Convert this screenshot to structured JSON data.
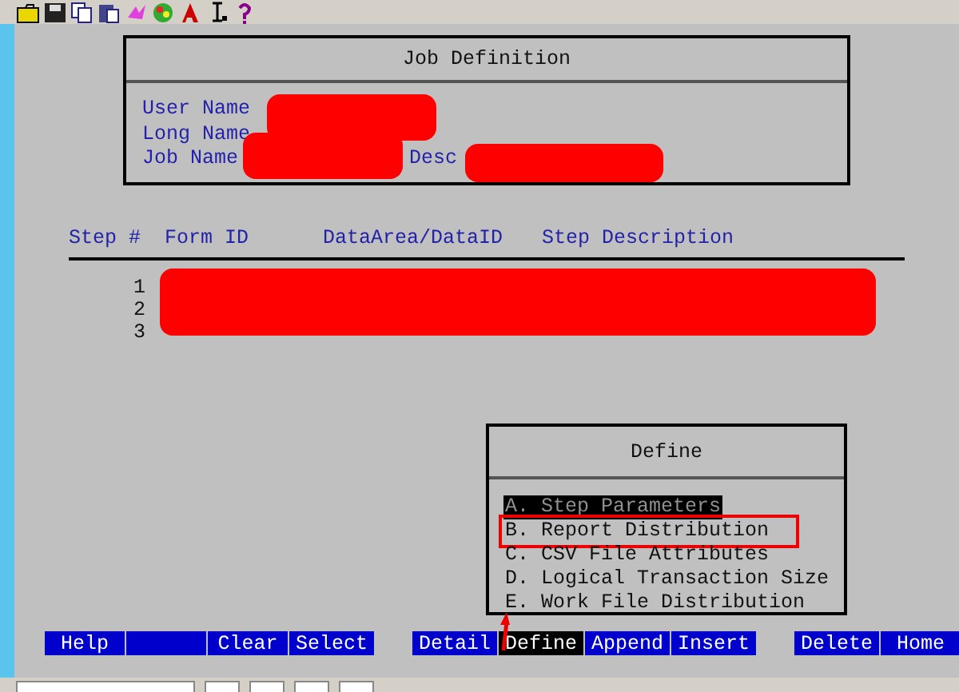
{
  "job_definition": {
    "title": "Job Definition",
    "fields": [
      {
        "label": "User Name"
      },
      {
        "label": "Long Name"
      },
      {
        "label": "Job Name"
      }
    ],
    "desc_label": "Desc"
  },
  "steps": {
    "columns": [
      "Step #",
      "Form ID",
      "DataArea/DataID",
      "Step Description"
    ],
    "rows": [
      {
        "step": "1"
      },
      {
        "step": "2"
      },
      {
        "step": "3"
      }
    ]
  },
  "define_menu": {
    "title": "Define",
    "items": [
      {
        "label": "A. Step Parameters",
        "selected": true,
        "annotated": false
      },
      {
        "label": "B. Report Distribution",
        "selected": false,
        "annotated": true
      },
      {
        "label": "C. CSV File Attributes",
        "selected": false,
        "annotated": false
      },
      {
        "label": "D. Logical Transaction Size",
        "selected": false,
        "annotated": false
      },
      {
        "label": "E. Work File Distribution",
        "selected": false,
        "annotated": false
      }
    ]
  },
  "function_key_groups": [
    [
      {
        "kind": "key",
        "label": "Help",
        "selected": false
      },
      {
        "kind": "blank",
        "selected": false
      },
      {
        "kind": "key",
        "label": "Clear",
        "selected": false
      },
      {
        "kind": "key",
        "label": "Select",
        "selected": false
      }
    ],
    [
      {
        "kind": "key",
        "label": "Detail",
        "selected": false
      },
      {
        "kind": "key",
        "label": "Define",
        "selected": true
      },
      {
        "kind": "key",
        "label": "Append",
        "selected": false
      },
      {
        "kind": "key",
        "label": "Insert",
        "selected": false
      }
    ],
    [
      {
        "kind": "key",
        "label": "Delete",
        "selected": false
      },
      {
        "kind": "key",
        "label": "Home",
        "selected": false
      }
    ]
  ]
}
